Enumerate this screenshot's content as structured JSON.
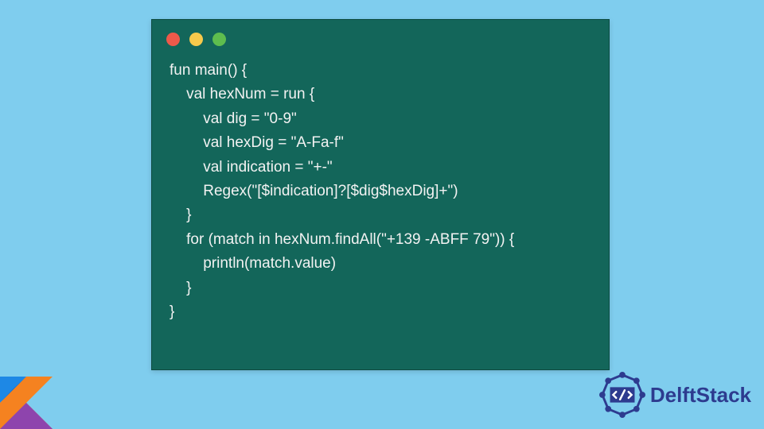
{
  "code": {
    "line1": "fun main() {",
    "line2": "    val hexNum = run {",
    "line3": "        val dig = \"0-9\"",
    "line4": "        val hexDig = \"A-Fa-f\"",
    "line5": "        val indication = \"+-\"",
    "line6": "        Regex(\"[$indication]?[$dig$hexDig]+\")",
    "line7": "    }",
    "line8": "    for (match in hexNum.findAll(\"+139 -ABFF 79\")) {",
    "line9": "        println(match.value)",
    "line10": "    }",
    "line11": "}"
  },
  "branding": {
    "name": "DelftStack"
  },
  "colors": {
    "background": "#7fcdee",
    "window": "#13665a",
    "text": "#f2f2f2",
    "brand": "#2d3b8f"
  }
}
